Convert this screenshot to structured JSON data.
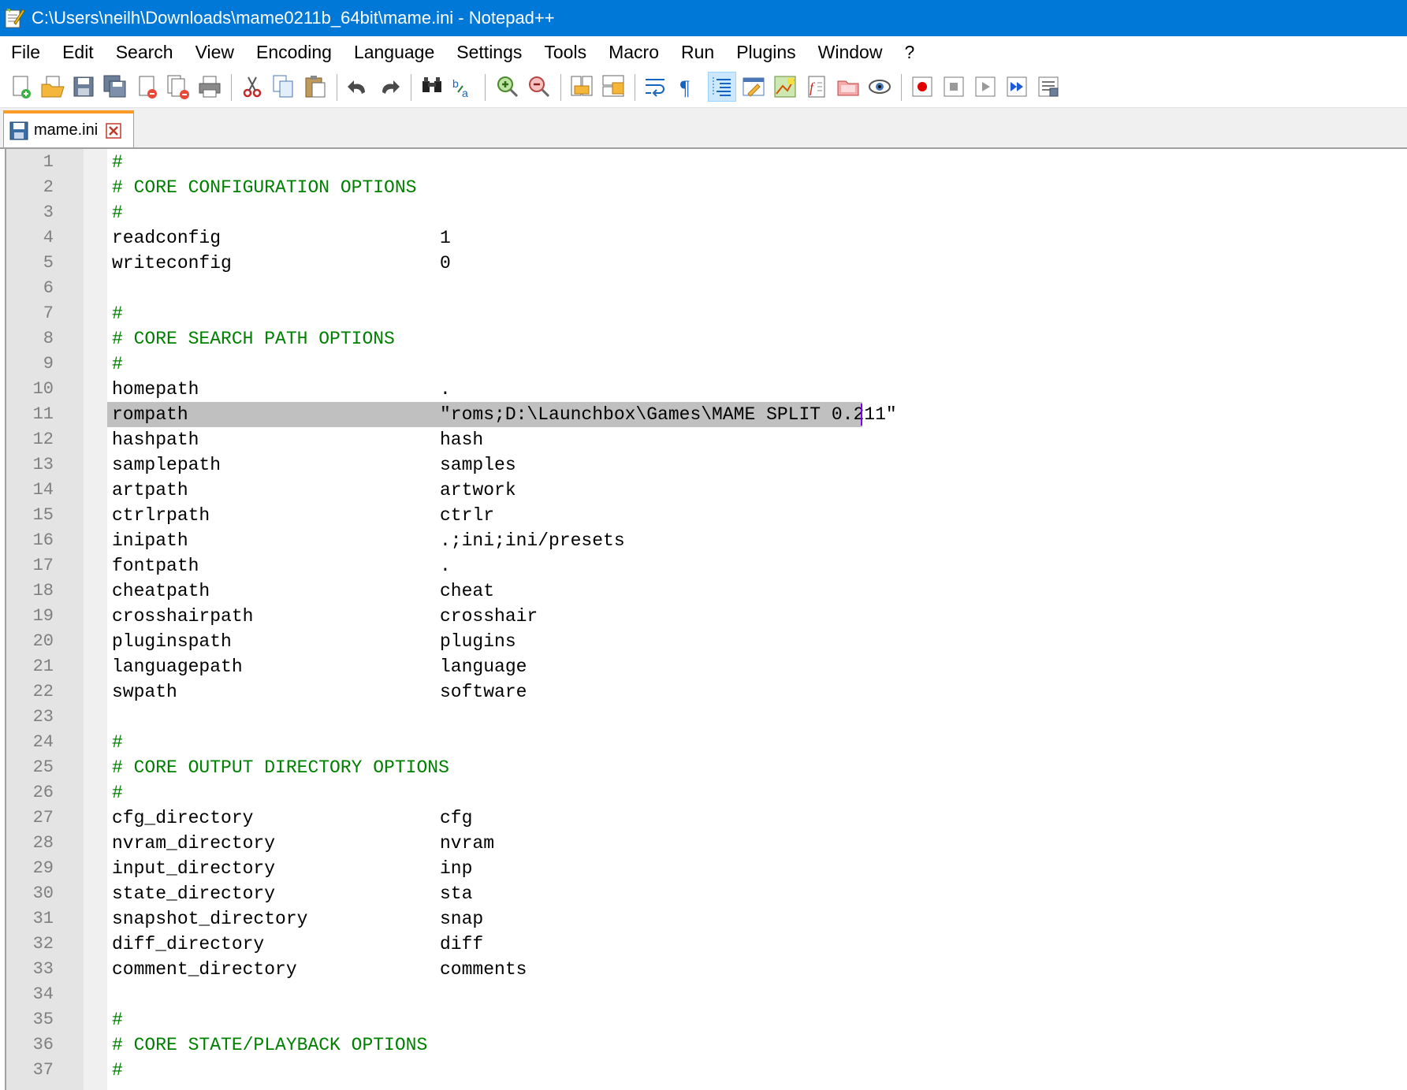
{
  "window": {
    "title": "C:\\Users\\neilh\\Downloads\\mame0211b_64bit\\mame.ini - Notepad++"
  },
  "menu": [
    "File",
    "Edit",
    "Search",
    "View",
    "Encoding",
    "Language",
    "Settings",
    "Tools",
    "Macro",
    "Run",
    "Plugins",
    "Window",
    "?"
  ],
  "toolbar": {
    "buttons": [
      "new-file",
      "open-file",
      "save",
      "save-all",
      "close",
      "close-all",
      "print",
      "cut",
      "copy",
      "paste",
      "undo",
      "redo",
      "find",
      "replace",
      "zoom-in",
      "zoom-out",
      "sync-vertical",
      "sync-horizontal",
      "word-wrap",
      "show-all-characters",
      "indent-guide",
      "user-defined-language",
      "document-map",
      "function-list",
      "folder-as-workspace",
      "monitoring",
      "record-macro",
      "stop-recording",
      "play-macro",
      "run-macro-multiple",
      "save-macro"
    ]
  },
  "tabs": [
    {
      "label": "mame.ini",
      "active": true
    }
  ],
  "editor": {
    "current_line": 11,
    "lines": [
      {
        "n": "1",
        "text": "#",
        "value": "",
        "comment": true
      },
      {
        "n": "2",
        "text": "# CORE CONFIGURATION OPTIONS",
        "value": "",
        "comment": true
      },
      {
        "n": "3",
        "text": "#",
        "value": "",
        "comment": true
      },
      {
        "n": "4",
        "text": "readconfig",
        "value": "1",
        "comment": false
      },
      {
        "n": "5",
        "text": "writeconfig",
        "value": "0",
        "comment": false
      },
      {
        "n": "6",
        "text": "",
        "value": "",
        "comment": false
      },
      {
        "n": "7",
        "text": "#",
        "value": "",
        "comment": true
      },
      {
        "n": "8",
        "text": "# CORE SEARCH PATH OPTIONS",
        "value": "",
        "comment": true
      },
      {
        "n": "9",
        "text": "#",
        "value": "",
        "comment": true
      },
      {
        "n": "10",
        "text": "homepath",
        "value": ".",
        "comment": false
      },
      {
        "n": "11",
        "text": "rompath",
        "value": "\"roms;D:\\Launchbox\\Games\\MAME SPLIT 0.211\"",
        "comment": false
      },
      {
        "n": "12",
        "text": "hashpath",
        "value": "hash",
        "comment": false
      },
      {
        "n": "13",
        "text": "samplepath",
        "value": "samples",
        "comment": false
      },
      {
        "n": "14",
        "text": "artpath",
        "value": "artwork",
        "comment": false
      },
      {
        "n": "15",
        "text": "ctrlrpath",
        "value": "ctrlr",
        "comment": false
      },
      {
        "n": "16",
        "text": "inipath",
        "value": ".;ini;ini/presets",
        "comment": false
      },
      {
        "n": "17",
        "text": "fontpath",
        "value": ".",
        "comment": false
      },
      {
        "n": "18",
        "text": "cheatpath",
        "value": "cheat",
        "comment": false
      },
      {
        "n": "19",
        "text": "crosshairpath",
        "value": "crosshair",
        "comment": false
      },
      {
        "n": "20",
        "text": "pluginspath",
        "value": "plugins",
        "comment": false
      },
      {
        "n": "21",
        "text": "languagepath",
        "value": "language",
        "comment": false
      },
      {
        "n": "22",
        "text": "swpath",
        "value": "software",
        "comment": false
      },
      {
        "n": "23",
        "text": "",
        "value": "",
        "comment": false
      },
      {
        "n": "24",
        "text": "#",
        "value": "",
        "comment": true
      },
      {
        "n": "25",
        "text": "# CORE OUTPUT DIRECTORY OPTIONS",
        "value": "",
        "comment": true
      },
      {
        "n": "26",
        "text": "#",
        "value": "",
        "comment": true
      },
      {
        "n": "27",
        "text": "cfg_directory",
        "value": "cfg",
        "comment": false
      },
      {
        "n": "28",
        "text": "nvram_directory",
        "value": "nvram",
        "comment": false
      },
      {
        "n": "29",
        "text": "input_directory",
        "value": "inp",
        "comment": false
      },
      {
        "n": "30",
        "text": "state_directory",
        "value": "sta",
        "comment": false
      },
      {
        "n": "31",
        "text": "snapshot_directory",
        "value": "snap",
        "comment": false
      },
      {
        "n": "32",
        "text": "diff_directory",
        "value": "diff",
        "comment": false
      },
      {
        "n": "33",
        "text": "comment_directory",
        "value": "comments",
        "comment": false
      },
      {
        "n": "34",
        "text": "",
        "value": "",
        "comment": false
      },
      {
        "n": "35",
        "text": "#",
        "value": "",
        "comment": true
      },
      {
        "n": "36",
        "text": "# CORE STATE/PLAYBACK OPTIONS",
        "value": "",
        "comment": true
      },
      {
        "n": "37",
        "text": "#",
        "value": "",
        "comment": true
      }
    ]
  }
}
